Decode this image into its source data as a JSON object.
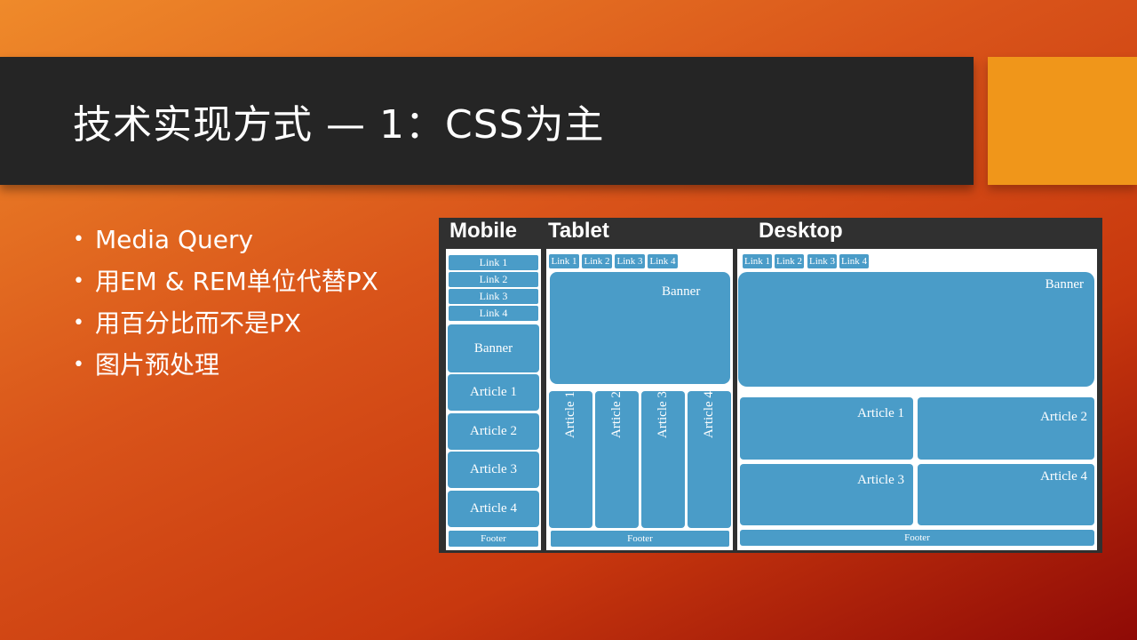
{
  "slide": {
    "title": "技术实现方式 — 1：CSS为主",
    "bullet_marker": "•",
    "bullets": [
      "Media Query",
      "用EM & REM单位代替PX",
      "用百分比而不是PX",
      "图片预处理"
    ]
  },
  "diagram": {
    "labels": {
      "mobile": "Mobile",
      "tablet": "Tablet",
      "desktop": "Desktop"
    },
    "links": [
      "Link 1",
      "Link 2",
      "Link 3",
      "Link 4"
    ],
    "banner": "Banner",
    "articles": [
      "Article 1",
      "Article 2",
      "Article 3",
      "Article 4"
    ],
    "footer": "Footer"
  },
  "colors": {
    "title_bar": "#252525",
    "accent": "#f0961a",
    "block": "#4a9cc8",
    "diagram_bg": "#303030"
  }
}
